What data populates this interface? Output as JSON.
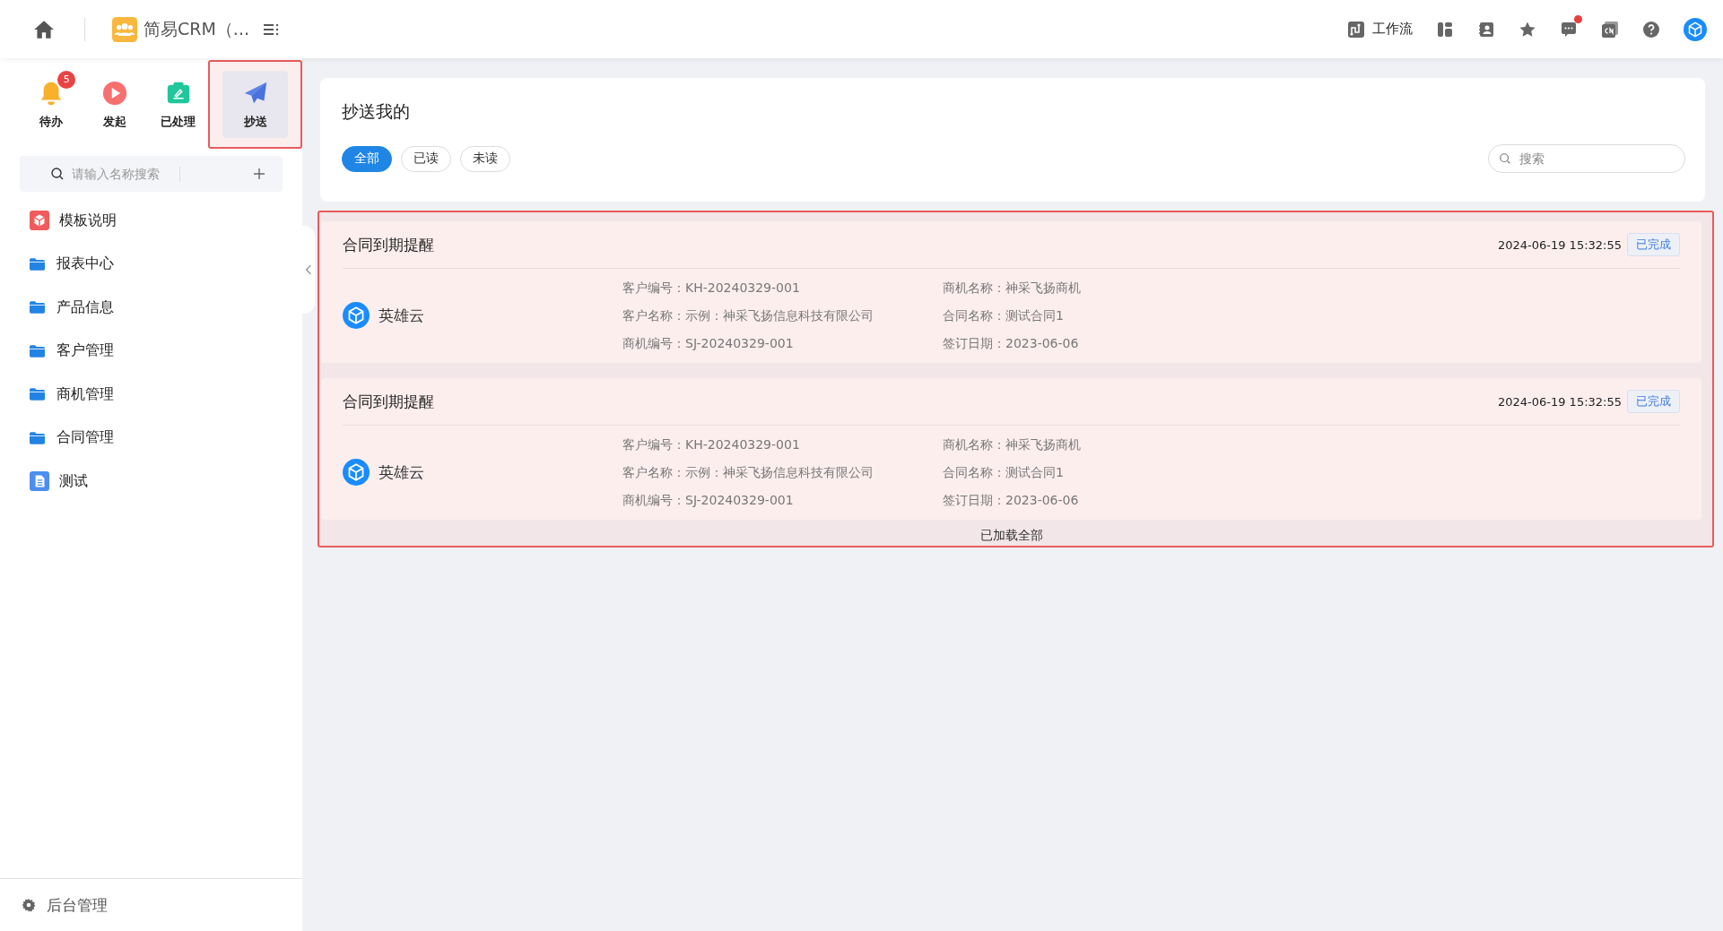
{
  "header": {
    "app_title": "简易CRM（...",
    "workflow_label": "工作流",
    "message_unread": true
  },
  "quick_actions": [
    {
      "kind": "bell",
      "label": "待办",
      "badge": "5",
      "selected": false
    },
    {
      "kind": "play",
      "label": "发起",
      "selected": false
    },
    {
      "kind": "done",
      "label": "已处理",
      "selected": false
    },
    {
      "kind": "send",
      "label": "抄送",
      "selected": true
    }
  ],
  "sidebar": {
    "search": {
      "placeholder": "请输入名称搜索"
    },
    "items": [
      {
        "kind": "template",
        "label": "模板说明"
      },
      {
        "kind": "folder",
        "label": "报表中心"
      },
      {
        "kind": "folder",
        "label": "产品信息"
      },
      {
        "kind": "folder",
        "label": "客户管理"
      },
      {
        "kind": "folder",
        "label": "商机管理"
      },
      {
        "kind": "folder",
        "label": "合同管理"
      },
      {
        "kind": "doc",
        "label": "测试"
      }
    ],
    "footer": "后台管理"
  },
  "content": {
    "title": "抄送我的",
    "filters": [
      {
        "label": "全部",
        "selected": true
      },
      {
        "label": "已读",
        "selected": false
      },
      {
        "label": "未读",
        "selected": false
      }
    ],
    "search": {
      "placeholder": "搜索"
    },
    "cards": [
      {
        "title": "合同到期提醒",
        "time": "2024-06-19 15:32:55",
        "status": "已完成",
        "app": "英雄云",
        "fields": [
          "客户编号：KH-20240329-001",
          "商机名称：神采飞扬商机",
          "客户名称：示例：神采飞扬信息科技有限公司",
          "合同名称：测试合同1",
          "商机编号：SJ-20240329-001",
          "签订日期：2023-06-06"
        ]
      },
      {
        "title": "合同到期提醒",
        "time": "2024-06-19 15:32:55",
        "status": "已完成",
        "app": "英雄云",
        "fields": [
          "客户编号：KH-20240329-001",
          "商机名称：神采飞扬商机",
          "客户名称：示例：神采飞扬信息科技有限公司",
          "合同名称：测试合同1",
          "商机编号：SJ-20240329-001",
          "签订日期：2023-06-06"
        ]
      }
    ],
    "end_note": "已加载全部"
  }
}
